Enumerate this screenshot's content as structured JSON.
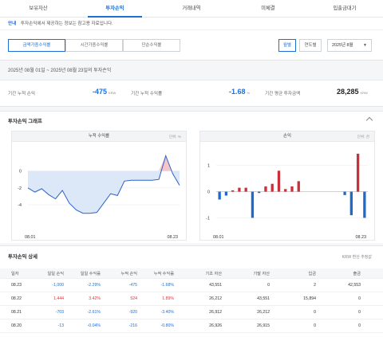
{
  "tabs": [
    "보유자산",
    "투자손익",
    "거래내역",
    "미체결",
    "입출금대기"
  ],
  "notice": {
    "label": "안내",
    "text": "투자손익에서 제공하는 정보는 참고용 자료입니다."
  },
  "filters": {
    "segments": [
      "금액가중수익률",
      "시간가중수익률",
      "단순수익률"
    ],
    "periods": [
      "월별",
      "연도별"
    ],
    "month_select": "2025년 8월"
  },
  "range": "2025년 08월 01일 ~ 2025년 08월 23일의 투자손익",
  "summary": {
    "cum_profit_label": "기간 누적 손익",
    "cum_profit_value": "-475",
    "cum_profit_unit": "KRW",
    "cum_rate_label": "기간 누적 수익률",
    "cum_rate_value": "-1.68",
    "cum_rate_unit": "%",
    "avg_invest_label": "기간 평균 투자금액",
    "avg_invest_value": "28,285",
    "avg_invest_unit": "KRW"
  },
  "graph": {
    "title": "투자손익 그래프",
    "colors": {
      "line": "#2d63c8",
      "fill": "#dce8f7",
      "positive": "#c8303a",
      "negative": "#1f69c9",
      "grid": "#eeeeee"
    }
  },
  "chart_data": [
    {
      "type": "area",
      "title": "누적 수익률",
      "unit": "단위: %",
      "x": [
        "08.01",
        "08.02",
        "08.03",
        "08.04",
        "08.05",
        "08.06",
        "08.07",
        "08.08",
        "08.09",
        "08.10",
        "08.11",
        "08.12",
        "08.13",
        "08.14",
        "08.15",
        "08.16",
        "08.17",
        "08.18",
        "08.19",
        "08.20",
        "08.21",
        "08.22",
        "08.23"
      ],
      "values": [
        -2.0,
        -2.5,
        -2.1,
        -2.8,
        -3.3,
        -2.3,
        -3.8,
        -4.6,
        -5.0,
        -5.0,
        -4.9,
        -3.8,
        -2.7,
        -2.9,
        -1.2,
        -1.1,
        -1.1,
        -1.1,
        -1.1,
        -1.0,
        1.8,
        -0.3,
        -1.7
      ],
      "ylim": [
        -5.5,
        2.5
      ],
      "yticks": [
        "0",
        "-2",
        "-4"
      ],
      "xticks": [
        "08.01",
        "08.23"
      ]
    },
    {
      "type": "bar",
      "title": "손익",
      "unit": "단위: 천",
      "x": [
        "08.01",
        "08.02",
        "08.03",
        "08.04",
        "08.05",
        "08.06",
        "08.07",
        "08.08",
        "08.09",
        "08.10",
        "08.11",
        "08.12",
        "08.13",
        "08.14",
        "08.15",
        "08.16",
        "08.17",
        "08.18",
        "08.19",
        "08.20",
        "08.21",
        "08.22",
        "08.23"
      ],
      "values": [
        -0.3,
        -0.15,
        0.05,
        0.15,
        0.15,
        -1.0,
        -0.05,
        0.2,
        0.3,
        0.8,
        0.1,
        0.2,
        0.4,
        0.0,
        0.0,
        0.0,
        0.0,
        0.0,
        0.0,
        -0.13,
        -0.9,
        1.45,
        -1.0
      ],
      "ylim": [
        -1.2,
        1.6
      ],
      "yticks": [
        "1",
        "0",
        "-1"
      ],
      "xticks": [
        "08.01",
        "08.23"
      ]
    }
  ],
  "detail": {
    "title": "투자손익 상세",
    "note": "KRW 환산 추정값",
    "headers": [
      "일자",
      "일일 손익",
      "일일 수익률",
      "누적 손익",
      "누적 수익률",
      "기초 자산",
      "기말 자산",
      "입금",
      "출금"
    ],
    "rows": [
      [
        "08.23",
        "-1,000",
        "-2.29%",
        "-475",
        "-1.68%",
        "43,551",
        "0",
        "2",
        "42,553"
      ],
      [
        "08.22",
        "1,444",
        "3.42%",
        "524",
        "1.89%",
        "26,212",
        "43,551",
        "15,894",
        "0"
      ],
      [
        "08.21",
        "-703",
        "-2.61%",
        "-920",
        "-3.40%",
        "26,912",
        "26,212",
        "0",
        "0"
      ],
      [
        "08.20",
        "-13",
        "-0.04%",
        "-216",
        "-0.80%",
        "26,926",
        "26,915",
        "0",
        "0"
      ]
    ]
  }
}
